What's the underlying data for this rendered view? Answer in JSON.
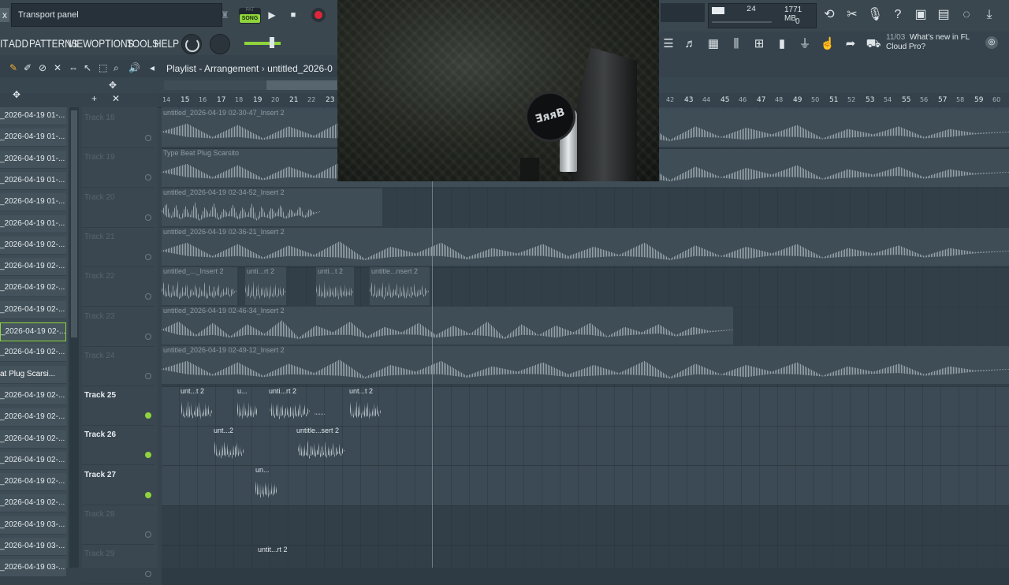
{
  "topbar": {
    "close": "x",
    "hint": "Transport panel",
    "pattern_label": "PAT",
    "song_label": "SONG",
    "play": "▶",
    "stop": "■",
    "cpu": "24",
    "memory": "1771 MB",
    "polyphony": "0",
    "cpu_meter_fill": 0.12
  },
  "menu": {
    "items": [
      "IT",
      "ADD",
      "PATTERNS",
      "VIEW",
      "OPTIONS",
      "TOOLS",
      "HELP"
    ]
  },
  "news": {
    "date": "11/03",
    "text1": "What's new in FL",
    "text2": "Cloud Pro?"
  },
  "playlist": {
    "title": "Playlist - Arrangement",
    "sep": "›",
    "file": "untitled_2026-0"
  },
  "ruler": {
    "ticks": [
      "14",
      "15",
      "16",
      "17",
      "18",
      "19",
      "20",
      "21",
      "22",
      "23",
      "42",
      "43",
      "44",
      "45",
      "46",
      "47",
      "48",
      "49",
      "50",
      "51",
      "52",
      "53",
      "54",
      "55",
      "56",
      "57",
      "58",
      "59",
      "60"
    ]
  },
  "picker": {
    "items": [
      "_2026-04-19 01-...",
      "_2026-04-19 01-...",
      "_2026-04-19 01-...",
      "_2026-04-19 01-...",
      "_2026-04-19 01-...",
      "_2026-04-19 01-...",
      "_2026-04-19 02-...",
      "_2026-04-19 02-...",
      "_2026-04-19 02-...",
      "_2026-04-19 02-...",
      "_2026-04-19 02-...",
      "_2026-04-19 02-...",
      "at Plug Scarsi...",
      "_2026-04-19 02-...",
      "_2026-04-19 02-...",
      "_2026-04-19 02-...",
      "_2026-04-19 02-...",
      "_2026-04-19 02-...",
      "_2026-04-19 02-...",
      "_2026-04-19 03-...",
      "_2026-04-19 03-...",
      "_2026-04-19 03-..."
    ]
  },
  "tracks": [
    {
      "label": "Track 18",
      "on": false
    },
    {
      "label": "Track 19",
      "on": false
    },
    {
      "label": "Track 20",
      "on": false
    },
    {
      "label": "Track 21",
      "on": false
    },
    {
      "label": "Track 22",
      "on": false
    },
    {
      "label": "Track 23",
      "on": false
    },
    {
      "label": "Track 24",
      "on": false
    },
    {
      "label": "Track 25",
      "on": true
    },
    {
      "label": "Track 26",
      "on": true
    },
    {
      "label": "Track 27",
      "on": true
    },
    {
      "label": "Track 28",
      "on": false
    },
    {
      "label": "Track 29",
      "on": false
    }
  ],
  "clips": {
    "t18": "untitled_2026-04-19 02-30-47_Insert 2",
    "t19": "Type Beat Plug Scarsito",
    "t20": "untitled_2026-04-19 02-34-52_Insert 2",
    "t21": "untitled_2026-04-19 02-36-21_Insert 2",
    "t22a": "untitled_..._Insert 2",
    "t22b": "unti...rt 2",
    "t22c": "unti...t 2",
    "t22d": "untitle...nsert 2",
    "t23": "untitled_2026-04-19 02-46-34_Insert 2",
    "t24": "untitled_2026-04-19 02-49-12_Insert 2",
    "t25a": "unt...t 2",
    "t25b": "u...",
    "t25c": "unti...rt 2",
    "t25d": "",
    "t25e": "unt...t 2",
    "t26a": "unt...2",
    "t26b": "untitle...sert 2",
    "t27a": "un...",
    "t29a": "untit...rt 2"
  },
  "webcam": {
    "logo": "ƎᴙᴙB"
  }
}
